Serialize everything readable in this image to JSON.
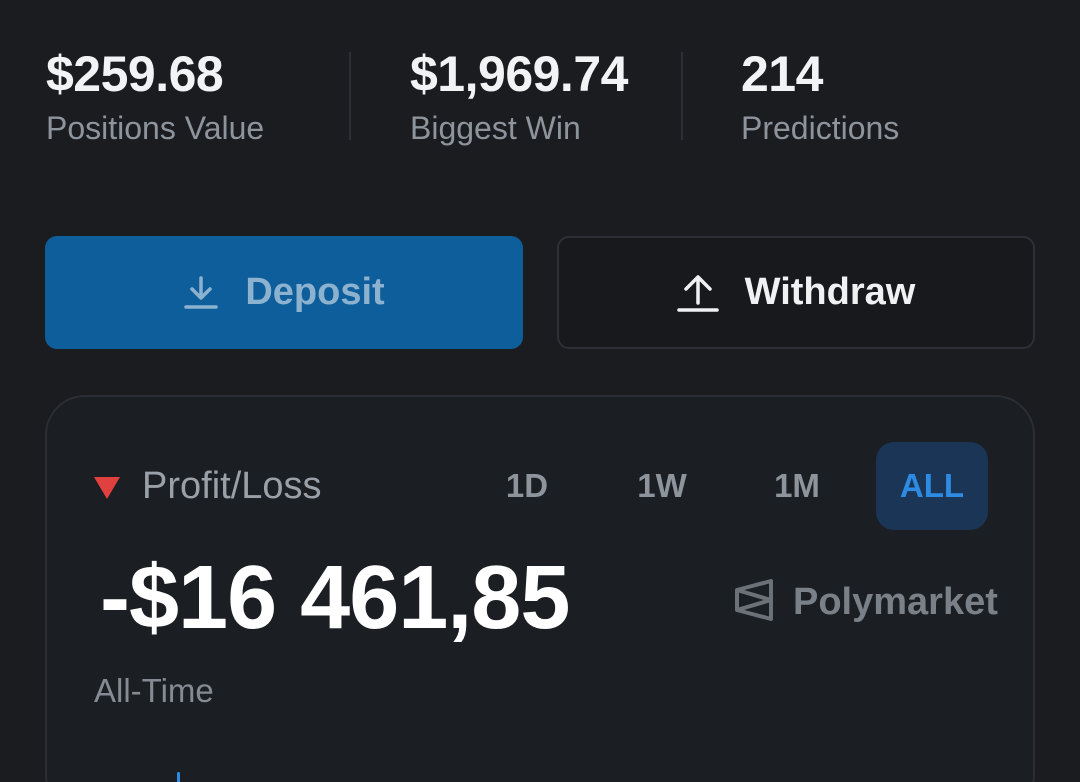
{
  "stats": [
    {
      "value": "$259.68",
      "label": "Positions Value"
    },
    {
      "value": "$1,969.74",
      "label": "Biggest Win"
    },
    {
      "value": "214",
      "label": "Predictions"
    }
  ],
  "actions": {
    "deposit_label": "Deposit",
    "withdraw_label": "Withdraw"
  },
  "pnl": {
    "title": "Profit/Loss",
    "trend": "down",
    "value": "-$16 461,85",
    "period_label": "All-Time",
    "brand": "Polymarket",
    "ranges": [
      "1D",
      "1W",
      "1M",
      "ALL"
    ],
    "active_range": "ALL"
  },
  "colors": {
    "background": "#1a1c20",
    "deposit": "#0d5e9a",
    "negative": "#e0403e",
    "accent": "#2e8be4"
  }
}
